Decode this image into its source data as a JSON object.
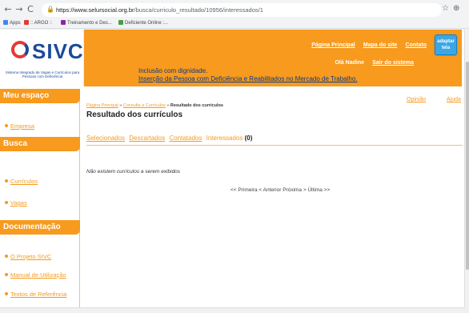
{
  "browser": {
    "url_host": "https://www.selursocial.org.br",
    "url_path": "/busca/curriculo_resultado/10956/interessados/1",
    "back_icon": "←",
    "forward_icon": "→",
    "reload_icon": "C",
    "lock_icon": "🔒",
    "star_icon": "☆",
    "profile_icon": "⊕",
    "bookmarks": [
      {
        "label": "Apps",
        "color": "#4285f4"
      },
      {
        "label": ":: ARGO ::",
        "color": "#e53935"
      },
      {
        "label": "Treinamento e Des...",
        "color": "#8e24aa"
      },
      {
        "label": "Deficiente Online :...",
        "color": "#43a047"
      }
    ]
  },
  "logo": {
    "text": "SIVC",
    "subtitle": "Sistema Integrado de Vagas e Currículos para Pessoas com Deficiência"
  },
  "header": {
    "links": [
      "Página Principal",
      "Mapa do site",
      "Contato"
    ],
    "greeting": "Olá Nadine",
    "logout": "Sair do sistema",
    "adapt_button": "adaptar tela",
    "slogan1": "Inclusão com dignidade.",
    "slogan2": "Inserção da Pessoa com Deficiência e Reabilitados no Mercado de Trabalho."
  },
  "sidebar": {
    "sections": [
      {
        "title": "Meu espaço",
        "items": [
          "Empresa"
        ]
      },
      {
        "title": "Busca",
        "items": [
          "Currículos",
          "Vagas"
        ]
      },
      {
        "title": "Documentação",
        "items": [
          "O Projeto SIVC",
          "Manual de Utilização",
          "Textos de Referência"
        ]
      }
    ]
  },
  "main": {
    "breadcrumb": {
      "home": "Página Principal",
      "sep": " » ",
      "search": "Consulta a Currículos",
      "current": "Resultado dos currículos"
    },
    "opiniao": "Opinião",
    "ajuda": "Ajuda",
    "title": "Resultado dos currículos",
    "tabs": [
      "Selecionados",
      "Descartados",
      "Contatados"
    ],
    "active_tab": "Interessados",
    "active_count": "(0)",
    "empty_message": "Não existem currículos a serem exibidos",
    "pager": "<< Primeira < Anterior Próxima > Última >>"
  },
  "colors": {
    "accent": "#f79a1d",
    "brand_blue": "#1a4a9c",
    "adapt_blue": "#3aa7e6"
  }
}
